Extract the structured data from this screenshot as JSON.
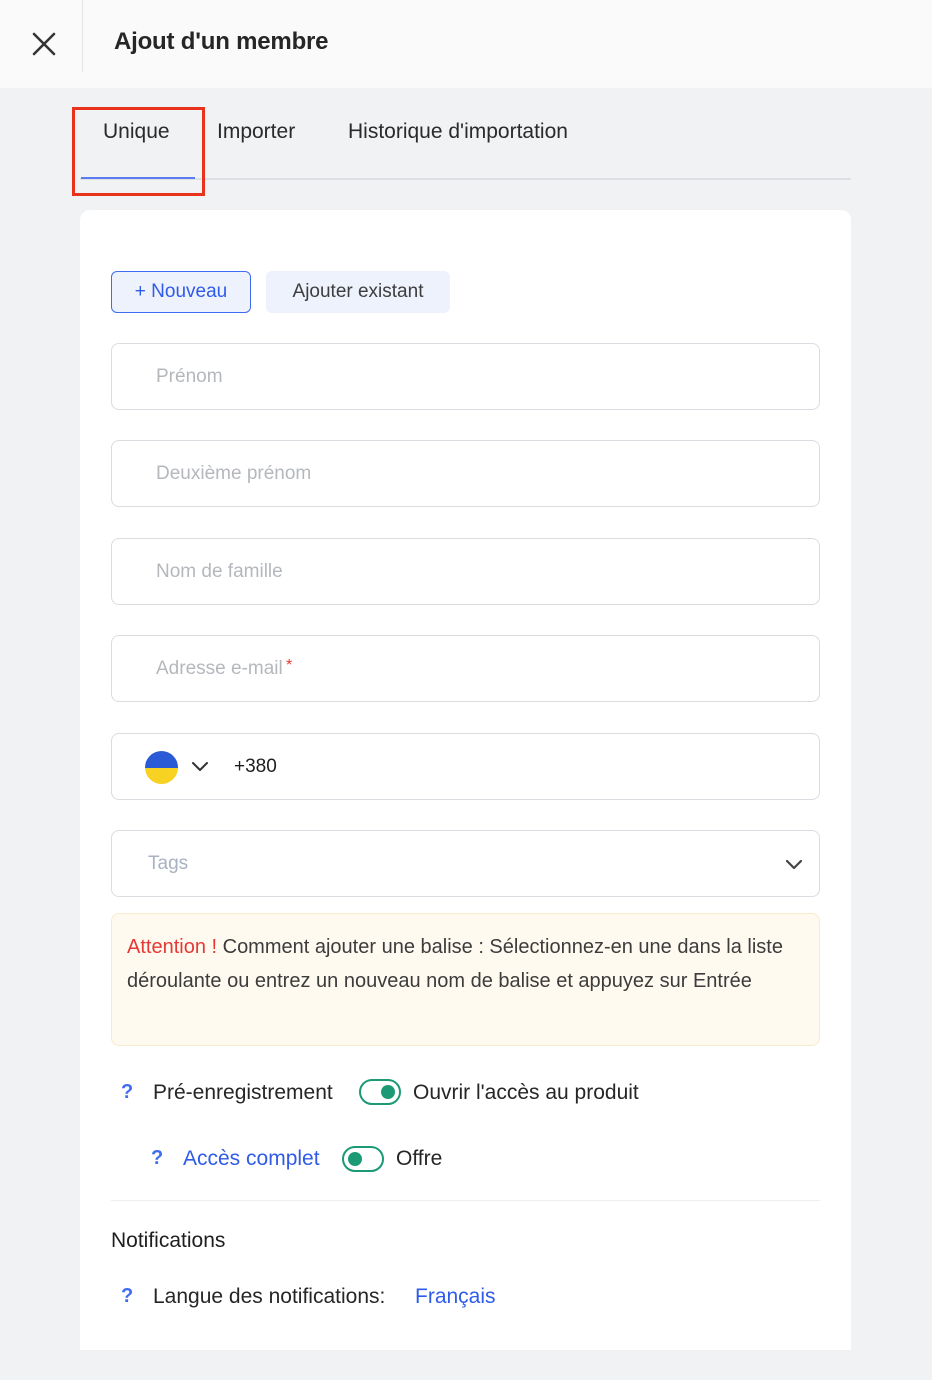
{
  "header": {
    "title": "Ajout d'un membre"
  },
  "tabs": [
    {
      "label": "Unique"
    },
    {
      "label": "Importer"
    },
    {
      "label": "Historique d'importation"
    }
  ],
  "actions": {
    "new_label": "+ Nouveau",
    "existing_label": "Ajouter existant"
  },
  "form": {
    "first_name_placeholder": "Prénom",
    "middle_name_placeholder": "Deuxième prénom",
    "last_name_placeholder": "Nom de famille",
    "email_placeholder": "Adresse e-mail",
    "email_required_mark": "*",
    "phone": {
      "country_flag": "Ukraine",
      "code": "+380"
    },
    "tags_placeholder": "Tags"
  },
  "attention": {
    "prefix": "Attention !",
    "text": " Comment ajouter une balise : Sélectionnez-en une dans la liste déroulante ou entrez un nouveau nom de balise et appuyez sur Entrée"
  },
  "access": {
    "help_mark": "?",
    "pre_registration_label": "Pré-enregistrement",
    "open_access_label": "Ouvrir l'accès au produit",
    "full_access_label": "Accès complet",
    "offer_label": "Offre"
  },
  "notifications": {
    "title": "Notifications",
    "language_label": "Langue des notifications:",
    "language_value": "Français"
  },
  "colors": {
    "accent": "#3f6cf0",
    "toggle": "#1b9a75",
    "warning": "#e53935",
    "highlight": "#e8321c"
  }
}
